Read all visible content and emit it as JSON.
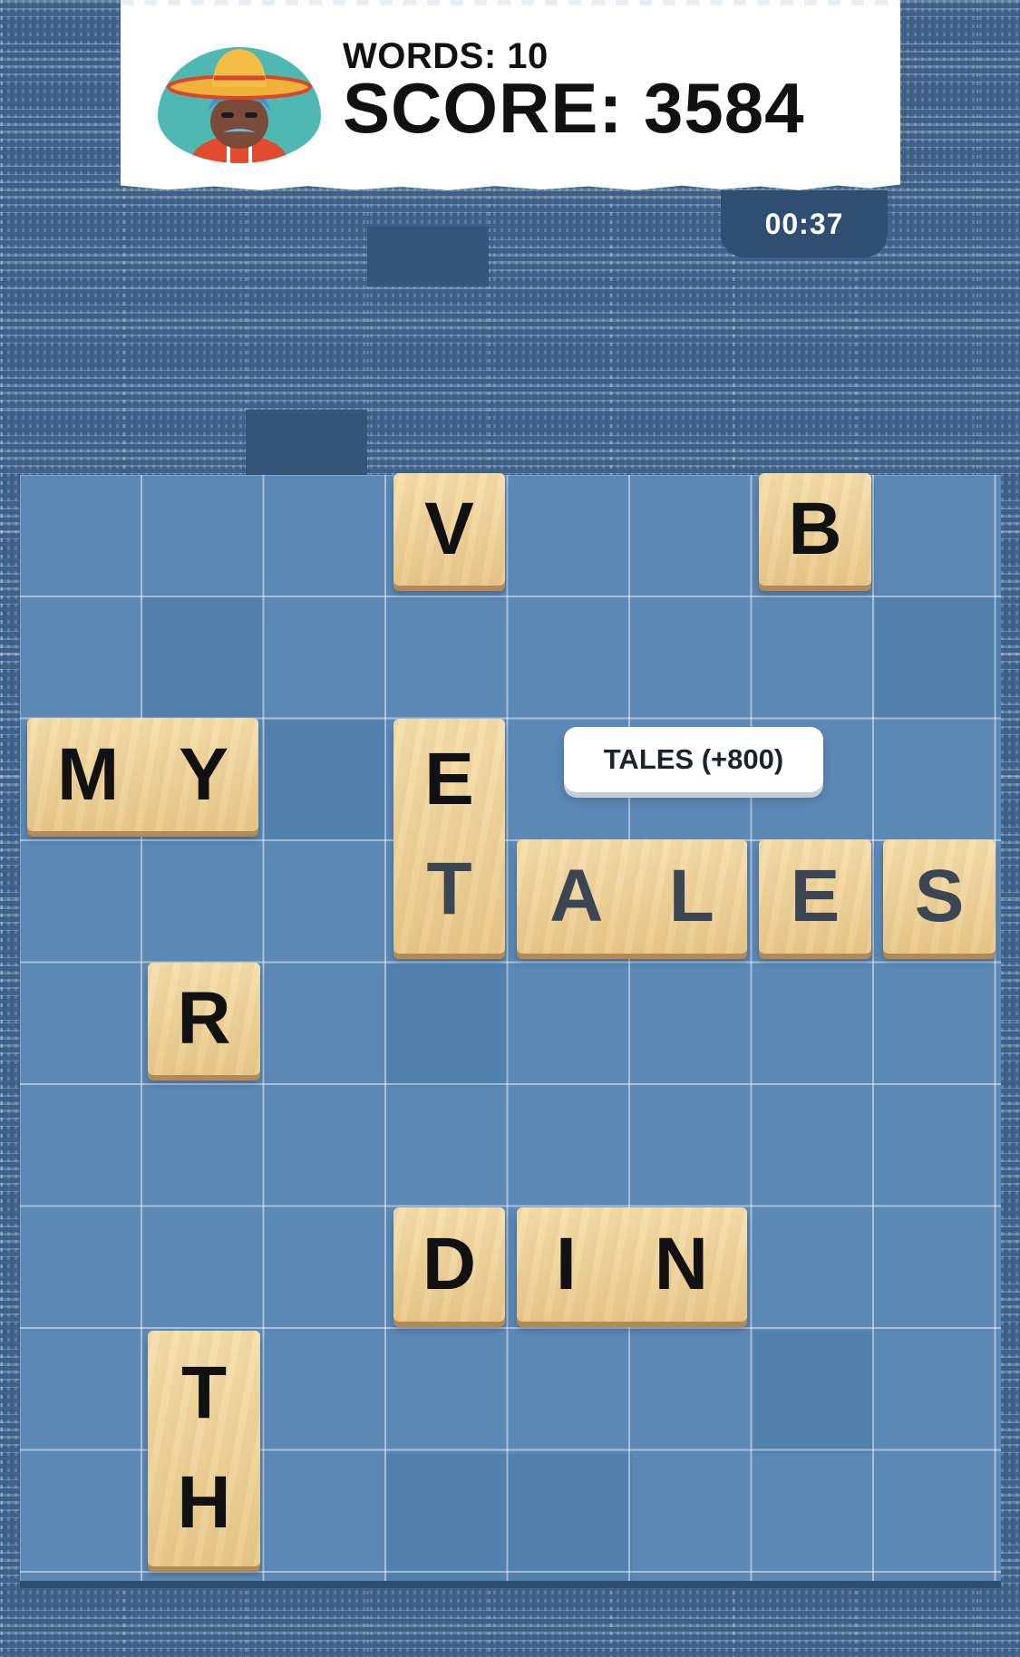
{
  "header": {
    "words_label": "WORDS: 10",
    "score_label": "SCORE: 3584",
    "avatar": "sombrero-man-avatar"
  },
  "timer": "00:37",
  "popup": "TALES (+800)",
  "tiles": {
    "v": "V",
    "b": "B",
    "my": [
      "M",
      "Y"
    ],
    "e": "E",
    "t": "T",
    "ales": [
      "A",
      "L",
      "E",
      "S"
    ],
    "r": "R",
    "d": "D",
    "in": [
      "I",
      "N"
    ],
    "th_t": "T",
    "th_h": "H"
  },
  "colors": {
    "background": "#3d6088",
    "board": "#5c88b6",
    "tile": "#f0d59c",
    "timer": "#2f4f72"
  }
}
